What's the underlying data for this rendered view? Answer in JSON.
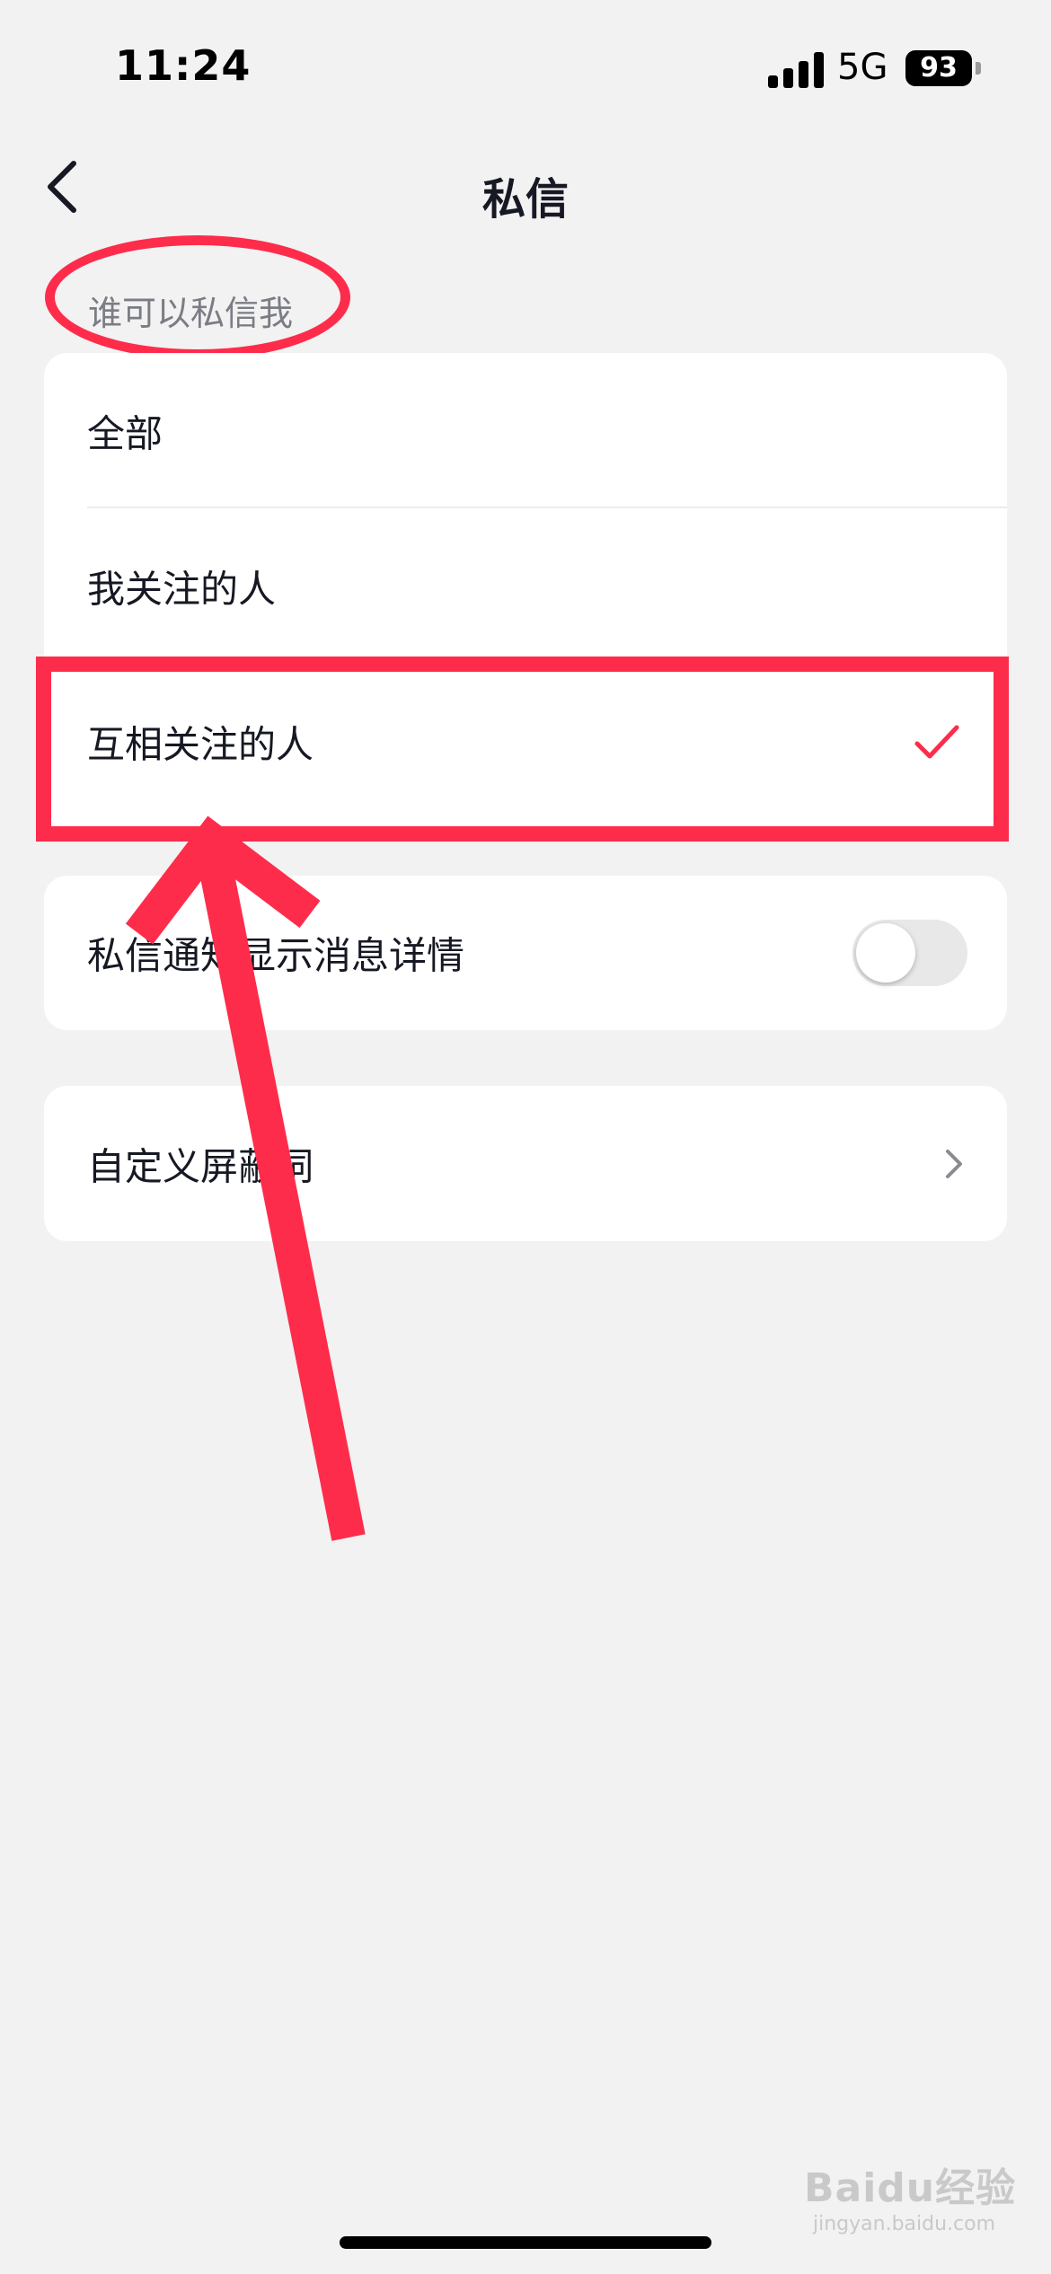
{
  "status_bar": {
    "time": "11:24",
    "network": "5G",
    "battery": "93"
  },
  "header": {
    "title": "私信"
  },
  "section": {
    "title": "谁可以私信我"
  },
  "privacy_options": [
    {
      "label": "全部",
      "selected": false
    },
    {
      "label": "我关注的人",
      "selected": false
    },
    {
      "label": "互相关注的人",
      "selected": true
    }
  ],
  "notification_setting": {
    "label": "私信通知显示消息详情",
    "enabled": false
  },
  "blocked_words": {
    "label": "自定义屏蔽词"
  },
  "watermark": {
    "text": "Baidu经验",
    "sub": "jingyan.baidu.com"
  },
  "colors": {
    "accent": "#fe2c4b",
    "background": "#f2f2f2",
    "card": "#ffffff",
    "text": "#161823",
    "muted": "#7c7d84"
  }
}
